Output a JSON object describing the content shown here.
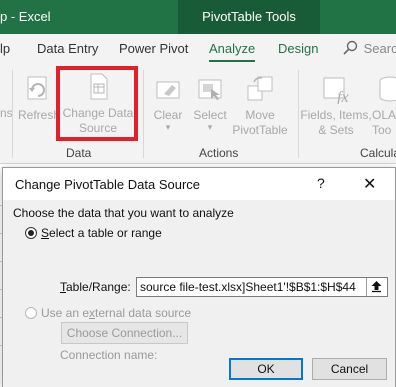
{
  "window": {
    "title": "p - Excel",
    "contextual_tab": "PivotTable Tools"
  },
  "tabs": [
    {
      "label": "lp"
    },
    {
      "label": "Data Entry"
    },
    {
      "label": "Power Pivot"
    },
    {
      "label": "Analyze"
    },
    {
      "label": "Design"
    }
  ],
  "search": {
    "placeholder": "Search"
  },
  "ribbon": {
    "left_partial": "ns",
    "data_group": {
      "label": "Data",
      "refresh": "Refresh",
      "change_source_line1": "Change Data",
      "change_source_line2": "Source"
    },
    "actions_group": {
      "label": "Actions",
      "clear": "Clear",
      "select": "Select",
      "move_line1": "Move",
      "move_line2": "PivotTable"
    },
    "calc_group": {
      "label": "Calculat",
      "fields_line1": "Fields, Items,",
      "fields_line2": "& Sets",
      "olap_line1": "OLA",
      "olap_line2": "Too"
    }
  },
  "dialog": {
    "title": "Change PivotTable Data Source",
    "help": "?",
    "close": "✕",
    "instruction": "Choose the data that you want to analyze",
    "option_table": "elect a table or range",
    "option_table_key": "S",
    "range_label_key": "T",
    "range_label": "able/Range:",
    "range_value": "source file-test.xlsx]Sheet1'!$B$1:$H$44",
    "option_external_prefix": "Use an e",
    "option_external_key": "x",
    "option_external_suffix": "ternal data source",
    "choose_connection": "Choose Connection...",
    "connection_name_label": "Connection name:",
    "ok": "OK",
    "cancel": "Cancel"
  },
  "colors": {
    "excel_green": "#217346",
    "context_green": "#185c37",
    "highlight_red": "#e0202a",
    "ok_border": "#0078d7"
  }
}
